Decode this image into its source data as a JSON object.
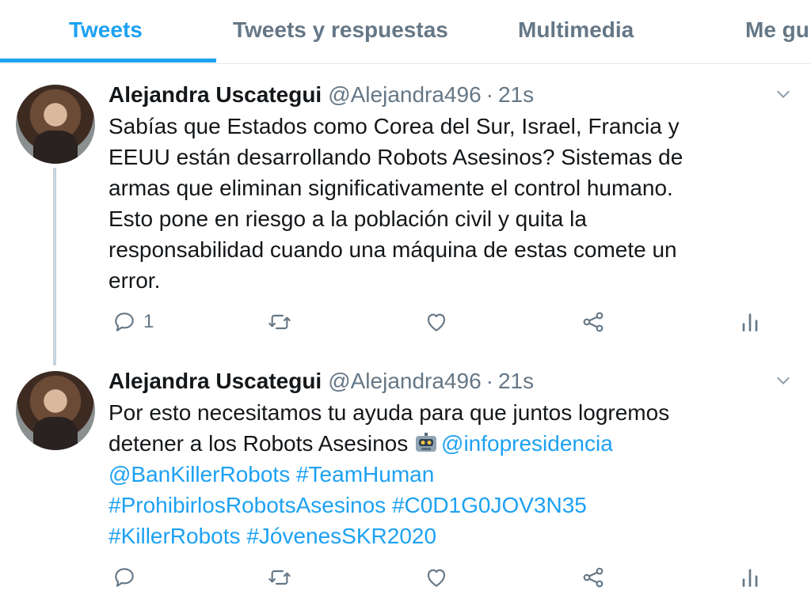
{
  "tabs": [
    {
      "label": "Tweets",
      "active": true
    },
    {
      "label": "Tweets y respuestas",
      "active": false
    },
    {
      "label": "Multimedia",
      "active": false
    },
    {
      "label": "Me gu",
      "active": false
    }
  ],
  "tweets": [
    {
      "name": "Alejandra Uscategui",
      "handle": "@Alejandra496",
      "separator": "·",
      "time": "21s",
      "text_lines": [
        "Sabías que Estados como Corea del Sur, Israel, Francia y",
        "EEUU están desarrollando Robots Asesinos? Sistemas de",
        "armas que eliminan significativamente el control humano.",
        "Esto pone en riesgo a la población civil y quita la",
        "responsabilidad cuando una máquina de estas comete un",
        "error."
      ],
      "reply_count": "1"
    },
    {
      "name": "Alejandra Uscategui",
      "handle": "@Alejandra496",
      "separator": "·",
      "time": "21s",
      "line1": "Por esto necesitamos tu ayuda para que juntos logremos",
      "line2_text": "detener a los Robots Asesinos ",
      "mention1": "@infopresidencia",
      "mention2": "@BanKillerRobots",
      "tag1": "#TeamHuman",
      "tag2": "#ProhibirlosRobotsAsesinos",
      "tag3": "#C0D1G0JOV3N35",
      "tag4": "#KillerRobots",
      "tag5": "#JóvenesSKR2020",
      "reply_count": ""
    }
  ],
  "colors": {
    "accent": "#1da1f2",
    "muted": "#657786",
    "text": "#14171a"
  },
  "icons": [
    "reply-icon",
    "retweet-icon",
    "like-icon",
    "share-icon",
    "analytics-icon",
    "chevron-down-icon",
    "robot-emoji"
  ]
}
